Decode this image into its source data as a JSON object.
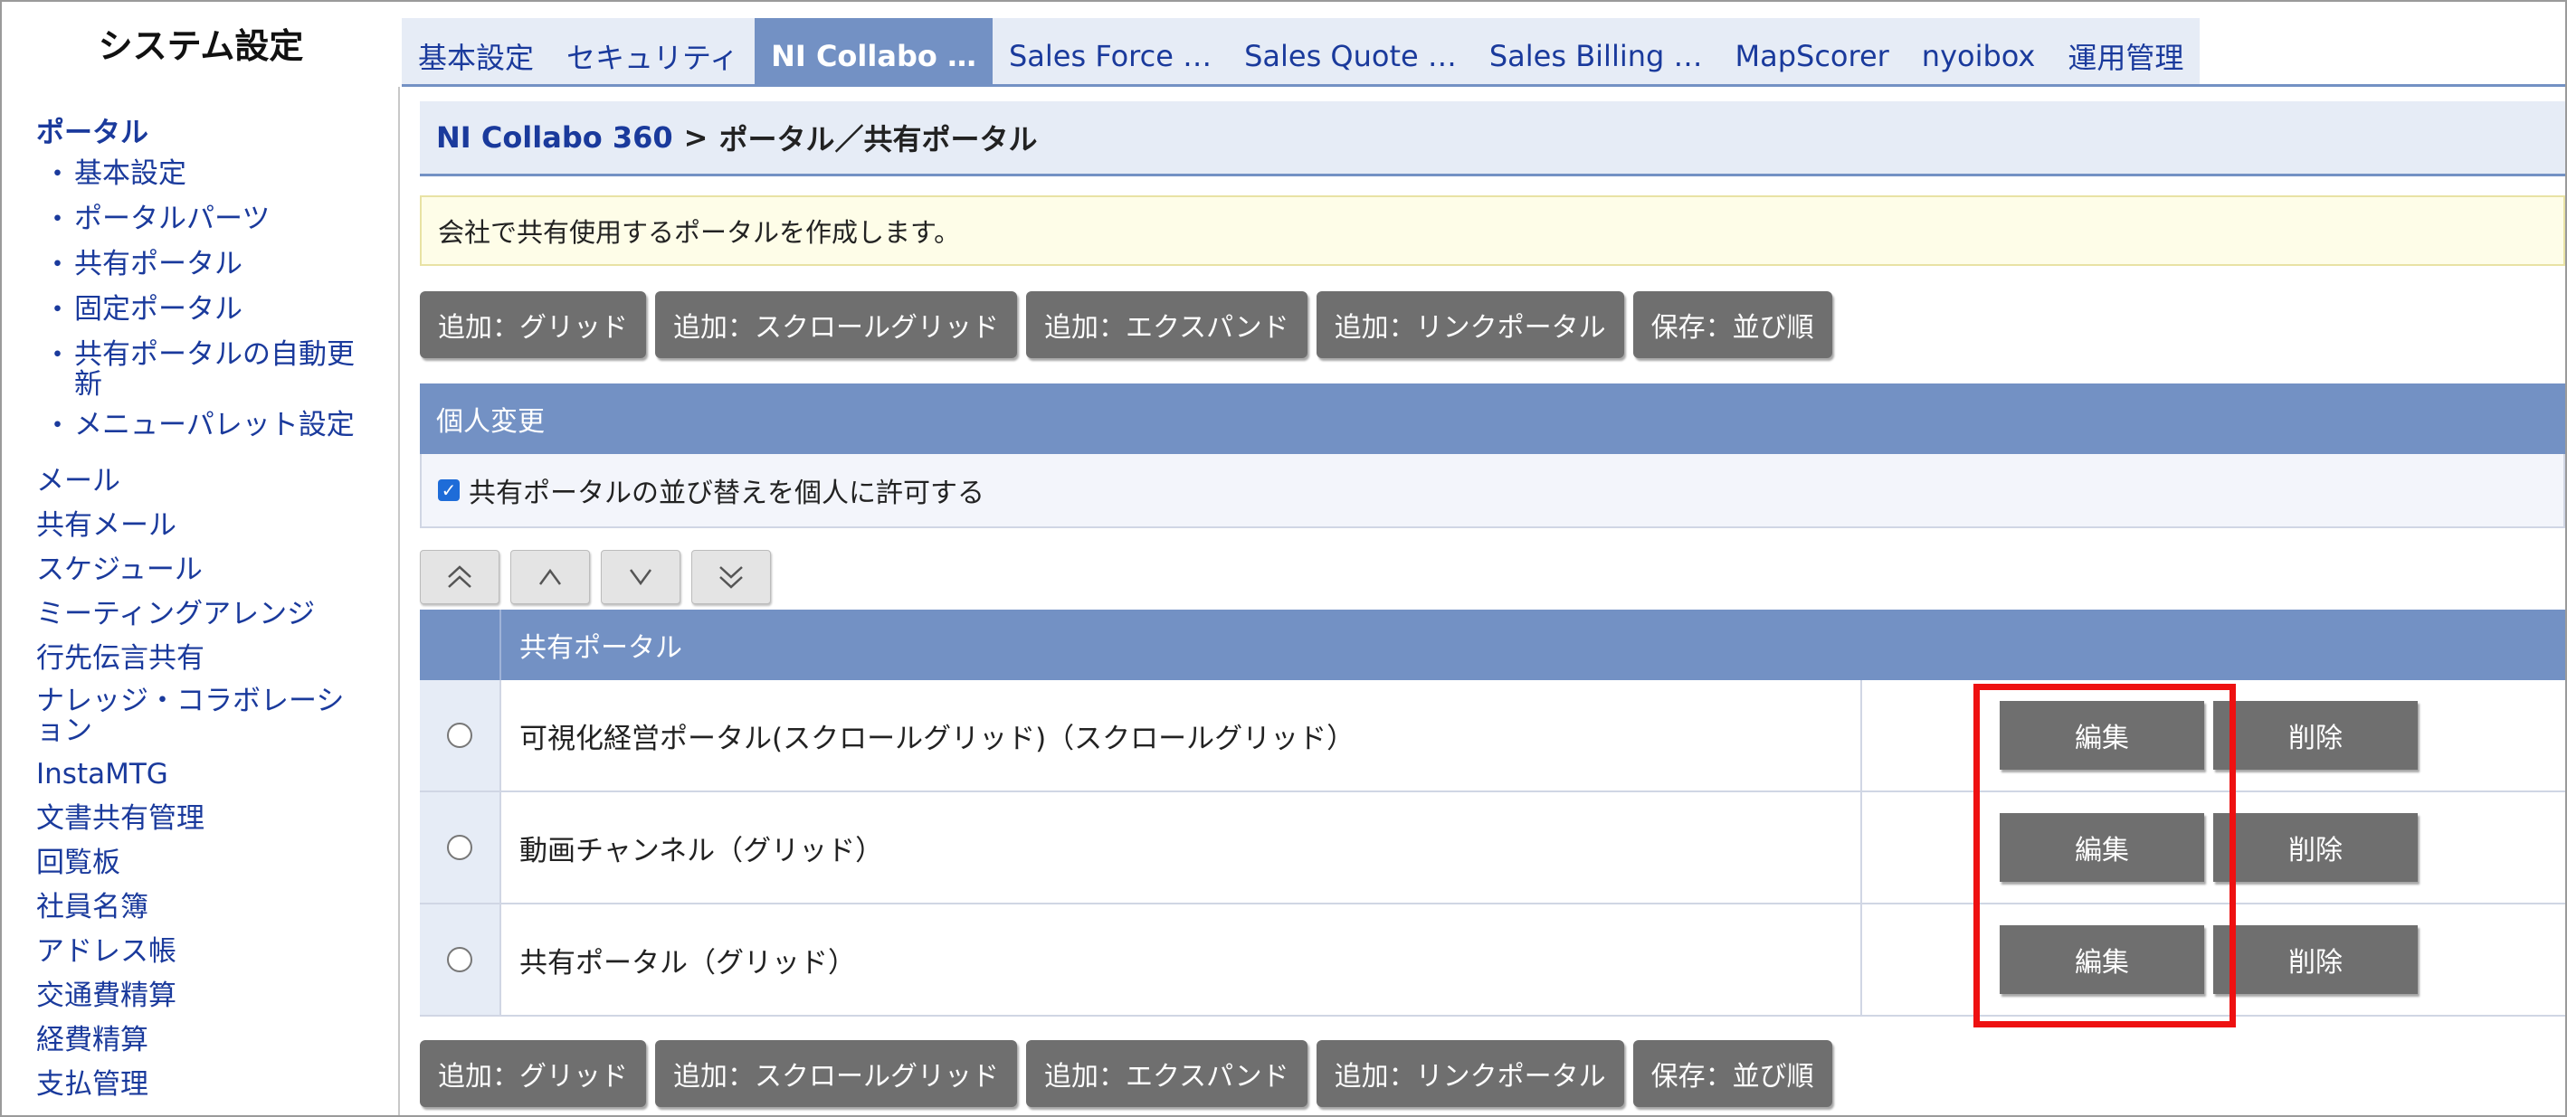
{
  "app_title": "システム設定",
  "tabs": [
    {
      "label": "基本設定",
      "active": false
    },
    {
      "label": "セキュリティ",
      "active": false
    },
    {
      "label": "NI Collabo …",
      "active": true
    },
    {
      "label": "Sales Force …",
      "active": false
    },
    {
      "label": "Sales Quote …",
      "active": false
    },
    {
      "label": "Sales Billing …",
      "active": false
    },
    {
      "label": "MapScorer",
      "active": false
    },
    {
      "label": "nyoibox",
      "active": false
    },
    {
      "label": "運用管理",
      "active": false
    }
  ],
  "sidebar": {
    "section": "ポータル",
    "subitems": [
      "基本設定",
      "ポータルパーツ",
      "共有ポータル",
      "固定ポータル",
      "共有ポータルの自動更新",
      "メニューパレット設定"
    ],
    "items": [
      "メール",
      "共有メール",
      "スケジュール",
      "ミーティングアレンジ",
      "行先伝言共有",
      "ナレッジ・コラボレーション",
      "InstaMTG",
      "文書共有管理",
      "回覧板",
      "社員名簿",
      "アドレス帳",
      "交通費精算",
      "経費精算",
      "支払管理"
    ]
  },
  "breadcrumb": {
    "link": "NI Collabo 360",
    "separator": ">",
    "current": "ポータル／共有ポータル"
  },
  "notice": "会社で共有使用するポータルを作成します。",
  "action_buttons": [
    "追加：グリッド",
    "追加：スクロールグリッド",
    "追加：エクスパンド",
    "追加：リンクポータル",
    "保存：並び順"
  ],
  "personal_change": {
    "title": "個人変更",
    "checkbox_label": "共有ポータルの並び替えを個人に許可する",
    "checked": true
  },
  "sort_buttons": [
    "move-top-icon",
    "move-up-icon",
    "move-down-icon",
    "move-bottom-icon"
  ],
  "table": {
    "header": "共有ポータル",
    "rows": [
      {
        "name": "可視化経営ポータル(スクロールグリッド)（スクロールグリッド）",
        "edit": "編集",
        "delete": "削除"
      },
      {
        "name": "動画チャンネル（グリッド）",
        "edit": "編集",
        "delete": "削除"
      },
      {
        "name": "共有ポータル（グリッド）",
        "edit": "編集",
        "delete": "削除"
      }
    ]
  },
  "colors": {
    "accent": "#7391c4",
    "link": "#1a3a9c",
    "button": "#6f6f6f",
    "highlight": "#ee1111"
  }
}
